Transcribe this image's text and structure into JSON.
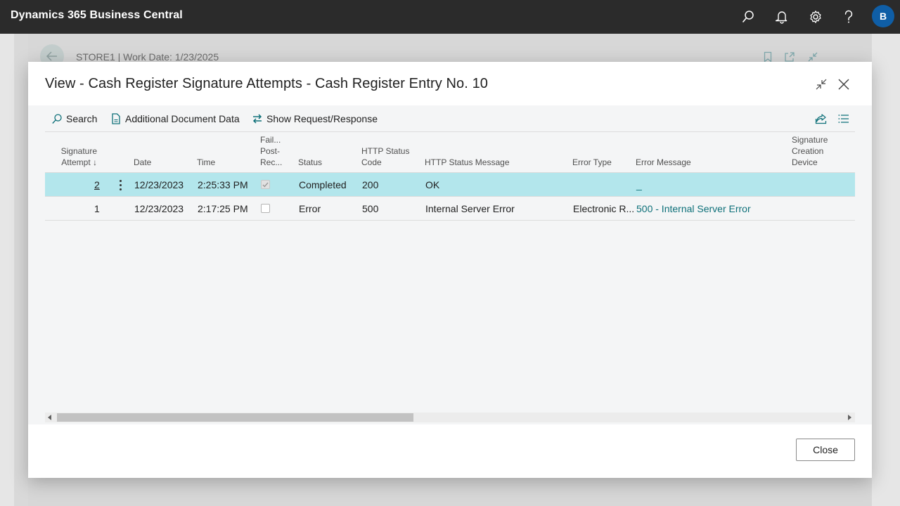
{
  "app": {
    "title": "Dynamics 365 Business Central",
    "avatar_initial": "B",
    "icons": [
      "search-icon",
      "bell-icon",
      "gear-icon",
      "help-icon"
    ]
  },
  "background_page": {
    "header_text": "STORE1 | Work Date: 1/23/2025",
    "icons": [
      "back-arrow-icon",
      "bookmark-icon",
      "open-new-window-icon",
      "collapse-icon"
    ]
  },
  "dialog": {
    "title": "View - Cash Register Signature Attempts - Cash Register Entry No. 10",
    "actions": {
      "search": "Search",
      "additional_document_data": "Additional Document Data",
      "show_request_response": "Show Request/Response"
    },
    "close_label": "Close"
  },
  "grid": {
    "headers": {
      "signature_attempt_l1": "Signature",
      "signature_attempt_l2": "Attempt",
      "sort_indicator": "↓",
      "date": "Date",
      "time": "Time",
      "failed_post_l1": "Fail...",
      "failed_post_l2": "Post-",
      "failed_post_l3": "Rec...",
      "status": "Status",
      "http_status_code_l1": "HTTP Status",
      "http_status_code_l2": "Code",
      "http_status_message": "HTTP Status Message",
      "error_type": "Error Type",
      "error_message": "Error Message",
      "signature_creation_device_l1": "Signature",
      "signature_creation_device_l2": "Creation",
      "signature_creation_device_l3": "Device"
    },
    "rows": [
      {
        "attempt": "2",
        "date": "12/23/2023",
        "time": "2:25:33 PM",
        "failed_post_receipt": true,
        "status": "Completed",
        "http_status_code": "200",
        "http_status_message": "OK",
        "error_type": "",
        "error_message": "_",
        "selected": true
      },
      {
        "attempt": "1",
        "date": "12/23/2023",
        "time": "2:17:25 PM",
        "failed_post_receipt": false,
        "status": "Error",
        "http_status_code": "500",
        "http_status_message": "Internal Server Error",
        "error_type": "Electronic R...",
        "error_message": "500 - Internal Server Error",
        "selected": false
      }
    ]
  },
  "colors": {
    "app_bar": "#2b2b2b",
    "accent": "#0e7079",
    "selected_row": "#b3e6ec",
    "avatar": "#0f5ea6"
  }
}
